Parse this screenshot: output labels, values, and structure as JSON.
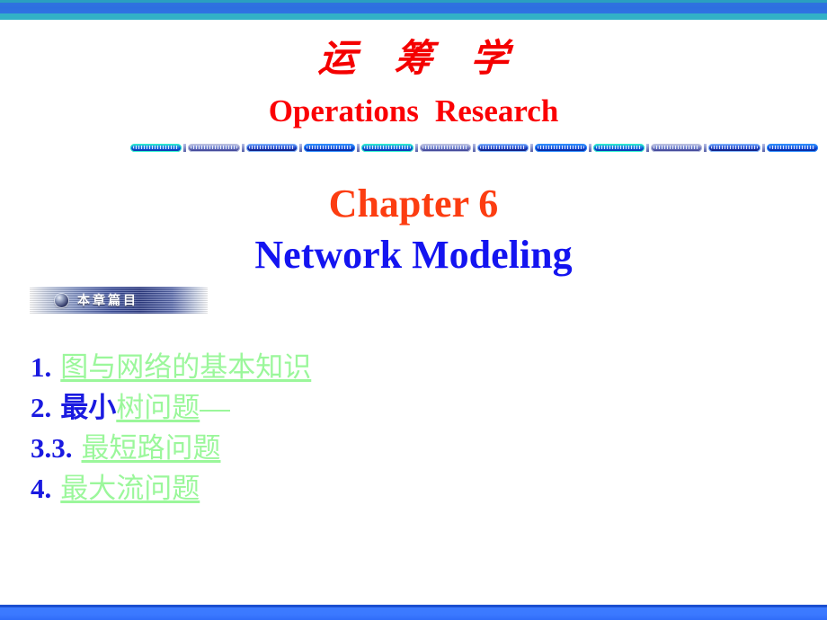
{
  "slide": {
    "course_title_cn": "运 筹 学",
    "course_title_en_part1": "Operations",
    "course_title_en_part2": "Research",
    "chapter_heading": "Chapter 6",
    "chapter_subheading": "Network Modeling",
    "badge_label": "本章篇目",
    "badge_icon": "sphere-icon",
    "colors": {
      "title_red": "#f40000",
      "chapter_orange": "#fc3d11",
      "subheading_blue": "#1414f0",
      "list_number_blue": "#1a1ae0",
      "list_link_green": "#9bf79b",
      "top_bar_blue": "#2d6fe0",
      "top_bar_teal": "#32b1c6",
      "bottom_bar_blue": "#3c7bff"
    },
    "contents": [
      {
        "number": "1.",
        "blue_text": "",
        "link_text": "图与网络的基本知识",
        "trailing_rule": false
      },
      {
        "number": "2.",
        "blue_text": "最小",
        "link_text": "树问题",
        "trailing_rule": true
      },
      {
        "number": "3.",
        "blue_text": "3.",
        "link_text": "最短路问题",
        "trailing_rule": false
      },
      {
        "number": "4.",
        "blue_text": "",
        "link_text": "最大流问题",
        "trailing_rule": false
      }
    ]
  }
}
